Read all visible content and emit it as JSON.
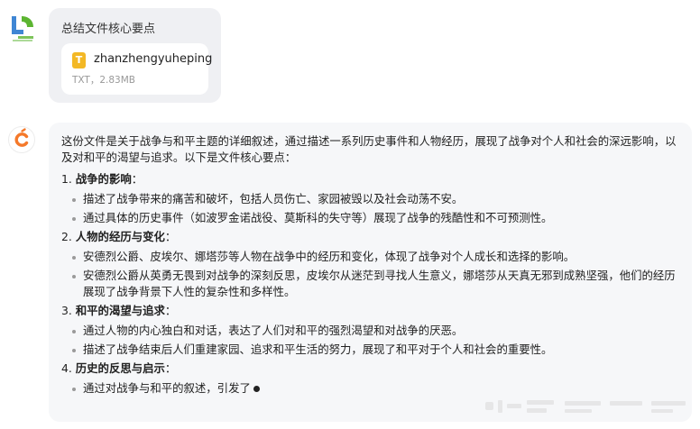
{
  "user": {
    "message": "总结文件核心要点",
    "file": {
      "icon_letter": "T",
      "name": "zhanzhengyuheping",
      "meta": "TXT，2.83MB"
    }
  },
  "assistant": {
    "intro": "这份文件是关于战争与和平主题的详细叙述，通过描述一系列历史事件和人物经历，展现了战争对个人和社会的深远影响，以及对和平的渴望与追求。以下是文件核心要点：",
    "sections": [
      {
        "num": "1.",
        "title": "战争的影响",
        "colon": "：",
        "points": [
          "描述了战争带来的痛苦和破坏，包括人员伤亡、家园被毁以及社会动荡不安。",
          "通过具体的历史事件（如波罗金诺战役、莫斯科的失守等）展现了战争的残酷性和不可预测性。"
        ]
      },
      {
        "num": "2.",
        "title": "人物的经历与变化",
        "colon": "：",
        "points": [
          "安德烈公爵、皮埃尔、娜塔莎等人物在战争中的经历和变化，体现了战争对个人成长和选择的影响。",
          "安德烈公爵从英勇无畏到对战争的深刻反思，皮埃尔从迷茫到寻找人生意义，娜塔莎从天真无邪到成熟坚强，他们的经历展现了战争背景下人性的复杂性和多样性。"
        ]
      },
      {
        "num": "3.",
        "title": "和平的渴望与追求",
        "colon": "：",
        "points": [
          "通过人物的内心独白和对话，表达了人们对和平的强烈渴望和对战争的厌恶。",
          "描述了战争结束后人们重建家园、追求和平生活的努力，展现了和平对于个人和社会的重要性。"
        ]
      },
      {
        "num": "4.",
        "title": "历史的反思与启示",
        "colon": "：",
        "points": [
          "通过对战争与和平的叙述，引发了"
        ]
      }
    ]
  },
  "colors": {
    "user_bubble": "#eff0f3",
    "assistant_bubble": "#f6f7f9",
    "file_icon": "#f3b825",
    "bot_logo": "#f5792a"
  }
}
